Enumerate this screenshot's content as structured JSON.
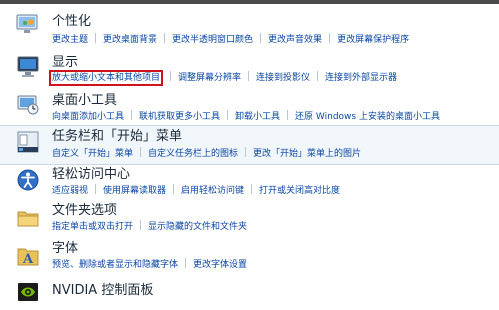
{
  "categories": [
    {
      "title": "个性化",
      "icon": "personalization-icon",
      "links": [
        "更改主题",
        "更改桌面背景",
        "更改半透明窗口颜色",
        "更改声音效果",
        "更改屏幕保护程序"
      ]
    },
    {
      "title": "显示",
      "icon": "display-icon",
      "links": [
        "放大或缩小文本和其他项目",
        "调整屏幕分辨率",
        "连接到投影仪",
        "连接到外部显示器"
      ],
      "highlighted_link": "放大或缩小文本和其他项目"
    },
    {
      "title": "桌面小工具",
      "icon": "desktop-gadgets-icon",
      "links": [
        "向桌面添加小工具",
        "联机获取更多小工具",
        "卸载小工具",
        "还原 Windows 上安装的桌面小工具"
      ]
    },
    {
      "title": "任务栏和「开始」菜单",
      "icon": "taskbar-icon",
      "links": [
        "自定义「开始」菜单",
        "自定义任务栏上的图标",
        "更改「开始」菜单上的图片"
      ]
    },
    {
      "title": "轻松访问中心",
      "icon": "ease-of-access-icon",
      "links": [
        "适应弱视",
        "使用屏幕读取器",
        "启用轻松访问键",
        "打开或关闭高对比度"
      ]
    },
    {
      "title": "文件夹选项",
      "icon": "folder-options-icon",
      "links": [
        "指定单击或双击打开",
        "显示隐藏的文件和文件夹"
      ]
    },
    {
      "title": "字体",
      "icon": "fonts-icon",
      "links": [
        "预览、删除或者显示和隐藏字体",
        "更改字体设置"
      ]
    },
    {
      "title": "NVIDIA 控制面板",
      "icon": "nvidia-icon",
      "links": []
    }
  ]
}
